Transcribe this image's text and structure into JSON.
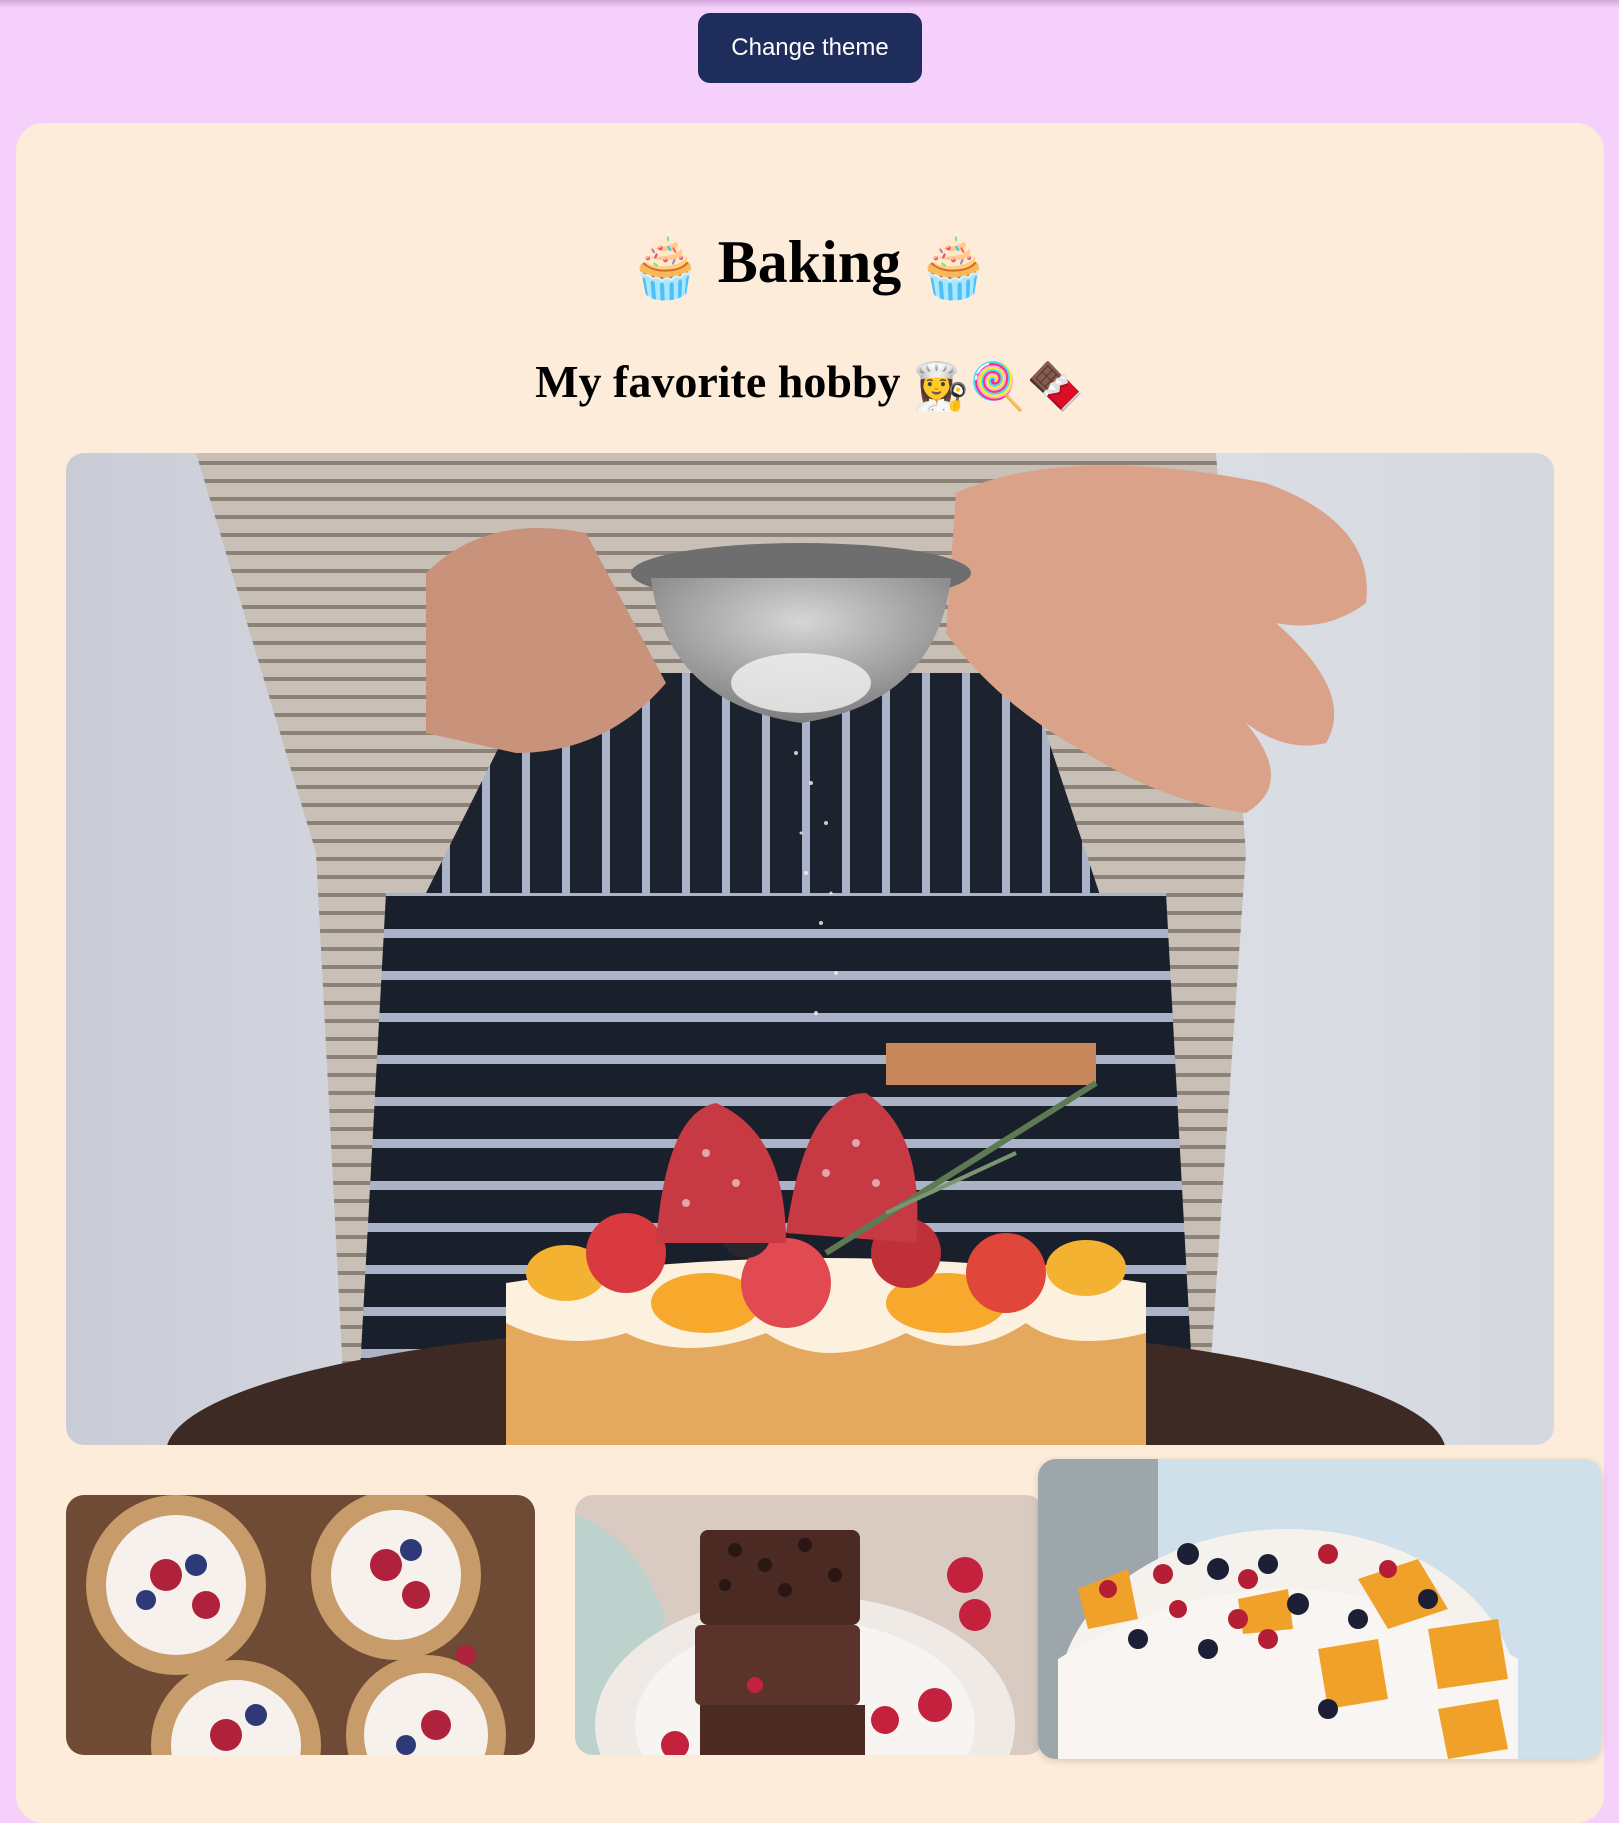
{
  "toolbar": {
    "change_theme_label": "Change theme"
  },
  "header": {
    "title": "Baking",
    "title_emoji": "🧁",
    "subtitle": "My favorite hobby",
    "subtitle_emojis": [
      "👩‍🍳",
      "🍭",
      "🍫"
    ]
  },
  "images": {
    "hero": "baker-dusting-sugar-on-fruit-cake",
    "gallery": [
      "berry-tarts",
      "chocolate-brownies",
      "fruit-cream-cake"
    ]
  },
  "colors": {
    "page_background": "#f5d0fb",
    "card_background": "#fdecd9",
    "button_background": "#1f2d5c",
    "button_text": "#ffffff"
  }
}
